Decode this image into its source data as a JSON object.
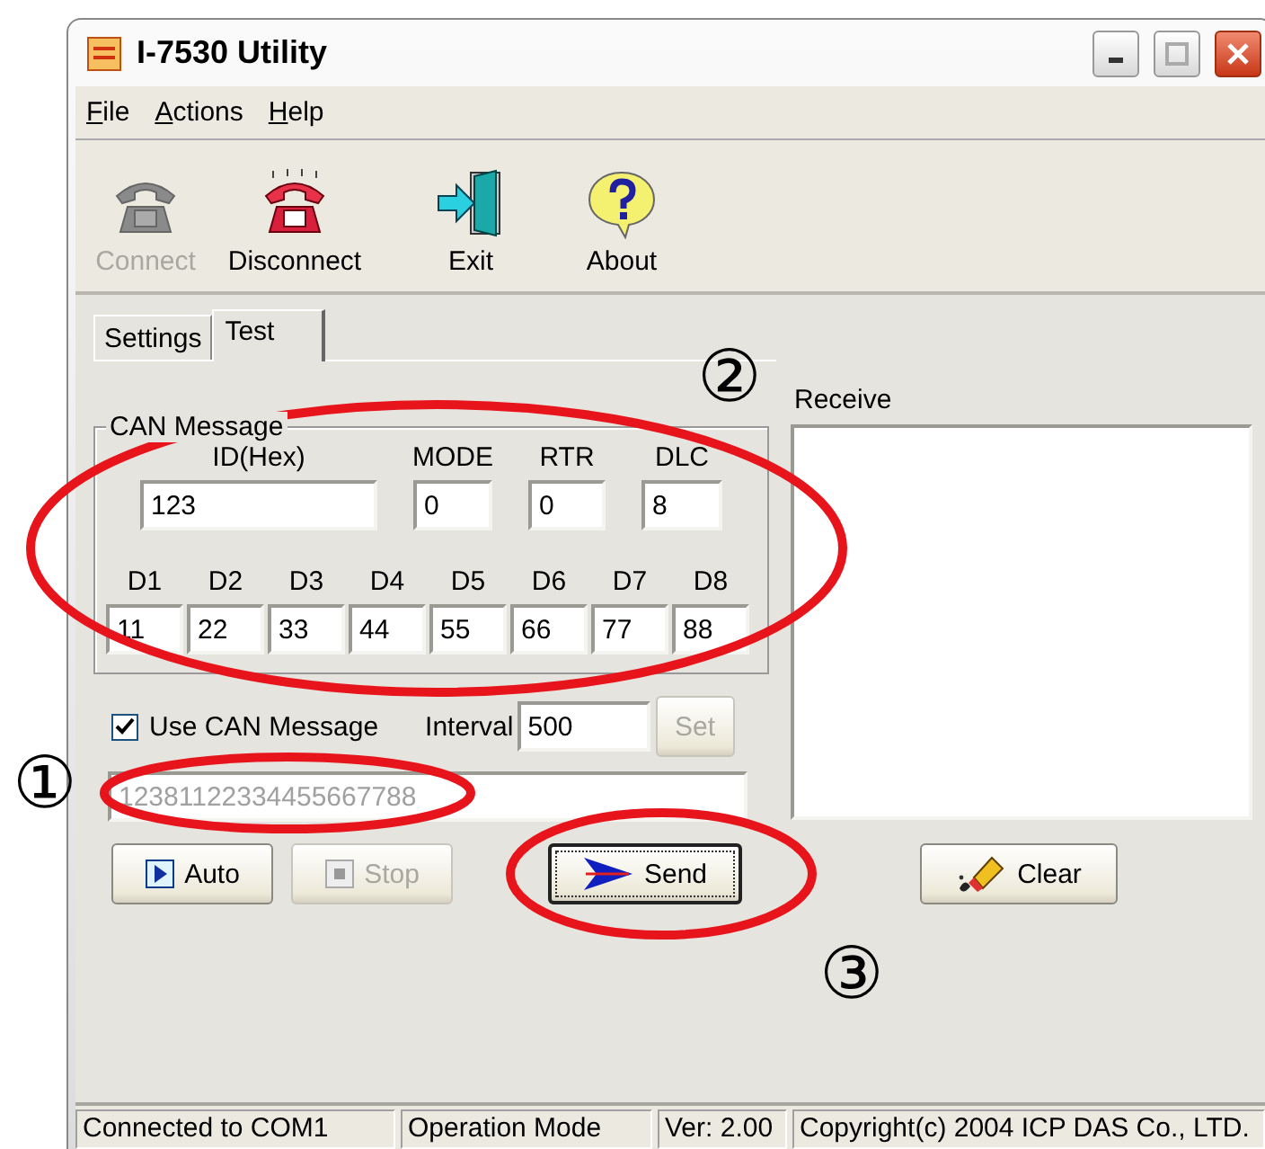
{
  "window": {
    "title": "I-7530 Utility"
  },
  "menu": [
    {
      "label": "File",
      "underline_first": true
    },
    {
      "label": "Actions",
      "underline_first": true
    },
    {
      "label": "Help",
      "underline_first": true
    }
  ],
  "toolbar": [
    {
      "label": "Connect",
      "kind": "connect",
      "disabled": true
    },
    {
      "label": "Disconnect",
      "kind": "disconnect",
      "disabled": false
    },
    {
      "label": "Exit",
      "kind": "exit",
      "disabled": false
    },
    {
      "label": "About",
      "kind": "about",
      "disabled": false
    }
  ],
  "tabs": [
    {
      "label": "Settings",
      "selected": false
    },
    {
      "label": "Test",
      "selected": true
    }
  ],
  "can_message": {
    "title": "CAN Message",
    "header_fields": [
      {
        "label": "ID(Hex)",
        "value": "123"
      },
      {
        "label": "MODE",
        "value": "0"
      },
      {
        "label": "RTR",
        "value": "0"
      },
      {
        "label": "DLC",
        "value": "8"
      }
    ],
    "data_fields": [
      {
        "label": "D1",
        "value": "11"
      },
      {
        "label": "D2",
        "value": "22"
      },
      {
        "label": "D3",
        "value": "33"
      },
      {
        "label": "D4",
        "value": "44"
      },
      {
        "label": "D5",
        "value": "55"
      },
      {
        "label": "D6",
        "value": "66"
      },
      {
        "label": "D7",
        "value": "77"
      },
      {
        "label": "D8",
        "value": "88"
      }
    ]
  },
  "use_can_message": {
    "label": "Use CAN Message",
    "checked": true
  },
  "interval": {
    "label": "Interval",
    "value": "500"
  },
  "set_button": {
    "label": "Set",
    "disabled": true
  },
  "message_field": {
    "value": "12381122334455667788",
    "disabled": true
  },
  "buttons": [
    {
      "label": "Auto",
      "kind": "auto",
      "disabled": false,
      "default": false
    },
    {
      "label": "Stop",
      "kind": "stop",
      "disabled": true,
      "default": false
    },
    {
      "label": "Send",
      "kind": "send",
      "disabled": false,
      "default": true
    }
  ],
  "receive": {
    "label": "Receive"
  },
  "clear_button": {
    "label": "Clear",
    "disabled": false
  },
  "status_bar": [
    "Connected to COM1",
    "Operation Mode",
    "Ver: 2.00",
    "Copyright(c) 2004 ICP DAS Co., LTD."
  ],
  "annotations": [
    {
      "kind": "ellipse"
    },
    {
      "kind": "ellipse"
    },
    {
      "kind": "ellipse"
    },
    {
      "kind": "number",
      "label": "①"
    },
    {
      "kind": "number",
      "label": "②"
    },
    {
      "kind": "number",
      "label": "③"
    }
  ]
}
